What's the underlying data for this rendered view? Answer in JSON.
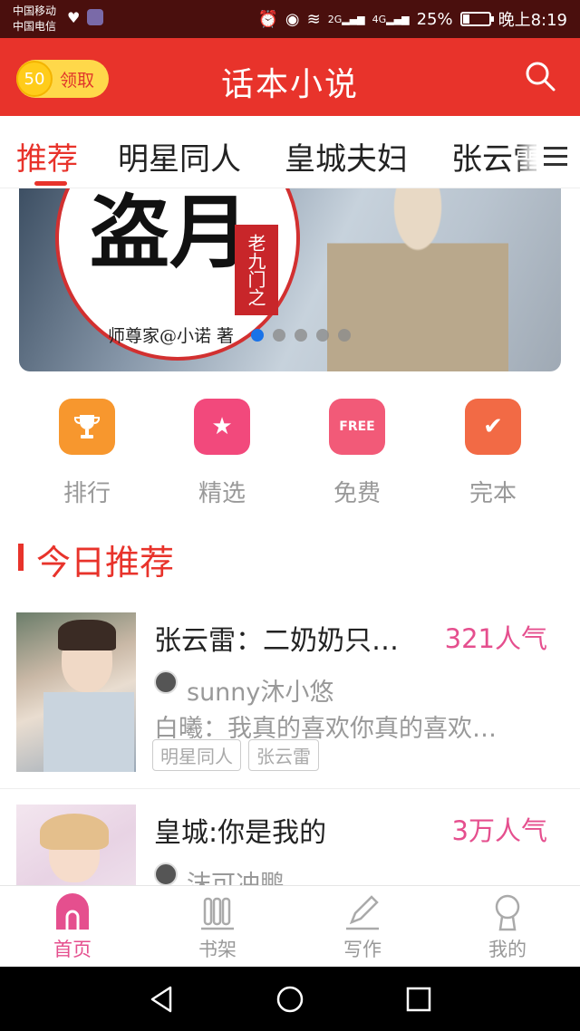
{
  "status_bar": {
    "carrier_1": "中国移动",
    "carrier_2": "中国电信",
    "network_2g": "2G",
    "network_4g": "4G",
    "battery": "25%",
    "battery_level": 0.25,
    "time": "晚上8:19"
  },
  "header": {
    "coin_count": "50",
    "coin_label": "领取",
    "title": "话本小说",
    "search_icon": "search-icon"
  },
  "tabs": [
    {
      "label": "推荐",
      "active": true
    },
    {
      "label": "明星同人",
      "active": false
    },
    {
      "label": "皇城夫妇",
      "active": false
    },
    {
      "label": "张云雷",
      "active": false
    }
  ],
  "banner": {
    "title_art": "盗月",
    "seal_text": "老九门之",
    "author_line": "师尊家@小诺 著",
    "slide_count": 5,
    "active_slide": 0
  },
  "categories": [
    {
      "label": "排行",
      "icon": "trophy-icon",
      "color": "#f7972e"
    },
    {
      "label": "精选",
      "icon": "star-icon",
      "color": "#f2497c"
    },
    {
      "label": "免费",
      "icon": "free-icon",
      "icon_text": "FREE",
      "color": "#f25a78"
    },
    {
      "label": "完本",
      "icon": "check-icon",
      "color": "#f26a45"
    }
  ],
  "section": {
    "title": "今日推荐"
  },
  "books": [
    {
      "title": "张云雷：二奶奶只…",
      "popularity": "321人气",
      "author": "sunny沐小悠",
      "description": "白曦：我真的喜欢你真的喜欢…",
      "tags": [
        "明星同人",
        "张云雷"
      ]
    },
    {
      "title": "皇城:你是我的",
      "popularity": "3万人气",
      "author": "沫可冲鹏",
      "description": "",
      "tags": []
    }
  ],
  "bottom_nav": [
    {
      "label": "首页",
      "icon": "home-icon",
      "active": true
    },
    {
      "label": "书架",
      "icon": "bookshelf-icon",
      "active": false
    },
    {
      "label": "写作",
      "icon": "pen-icon",
      "active": false
    },
    {
      "label": "我的",
      "icon": "profile-icon",
      "active": false
    }
  ],
  "colors": {
    "brand_red": "#e8332b",
    "popularity_pink": "#e54f8e",
    "status_bar": "#4a0f0d",
    "active_dot": "#1a73e8"
  }
}
